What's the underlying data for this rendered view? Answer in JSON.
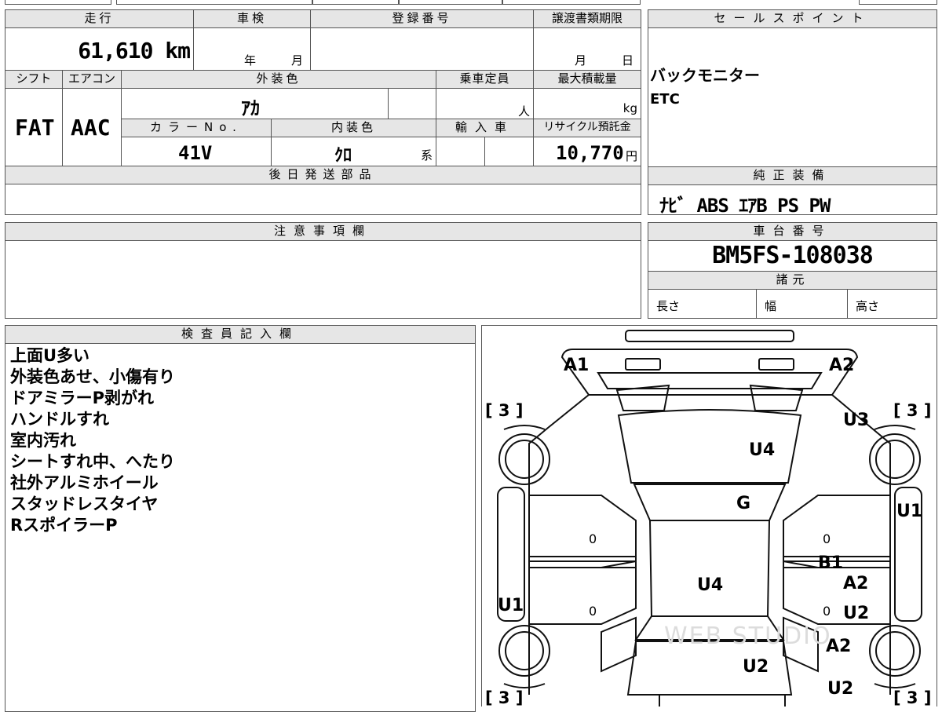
{
  "top_sheet": {
    "headers": {
      "mileage": "走行",
      "inspection": "車検",
      "registration": "登録番号",
      "transfer_deadline": "譲渡書類期限",
      "shift": "シフト",
      "aircon": "エアコン",
      "exterior_color": "外装色",
      "capacity": "乗車定員",
      "max_load": "最大積載量",
      "color_no": "カラーNo.",
      "interior_color": "内装色",
      "import": "輸入車",
      "recycle_fee": "リサイクル預託金",
      "later_parts": "後日発送部品",
      "notes": "注意事項欄"
    },
    "mileage_value": "61,610 km",
    "inspection_year_unit": "年",
    "inspection_month_unit": "月",
    "deadline_month_unit": "月",
    "deadline_day_unit": "日",
    "shift_value": "FAT",
    "aircon_value": "AAC",
    "exterior_color_value": "ｱｶ",
    "capacity_unit": "人",
    "max_load_unit": "kg",
    "color_no_value": "41V",
    "interior_color_value": "ｸﾛ",
    "interior_color_suffix": "系",
    "recycle_fee_value": "10,770",
    "recycle_fee_unit": "円"
  },
  "right_panel": {
    "sales_points_header": "セールスポイント",
    "sales_points": [
      "バックモニター",
      "ETC"
    ],
    "genuine_equipment_header": "純正装備",
    "genuine_equipment_value": "ﾅﾋﾞ  ABS ｴｱB PS PW",
    "chassis_number_header": "車台番号",
    "chassis_number_value": "BM5FS-108038",
    "specs_header": "諸元",
    "length_label": "長さ",
    "width_label": "幅",
    "height_label": "高さ"
  },
  "inspector": {
    "header": "検査員記入欄",
    "lines": [
      "上面U多い",
      "外装色あせ、小傷有り",
      "ドアミラーP剥がれ",
      "ハンドルすれ",
      "室内汚れ",
      "シートすれ中、へたり",
      "社外アルミホイール",
      "スタッドレスタイヤ",
      "RスポイラーP"
    ]
  },
  "diagram": {
    "marks": {
      "a1_front_left": "A1",
      "a2_front_right": "A2",
      "u3_right_front": "U3",
      "u4_hood": "U4",
      "g_windshield": "G",
      "u1_right": "U1",
      "b1_right_pillar": "B1",
      "a2_right_door": "A2",
      "u4_roof": "U4",
      "u1_left": "U1",
      "u2_right_rear_door": "U2",
      "a2_right_rear": "A2",
      "u2_trunk": "U2",
      "u2_rear_right": "U2"
    },
    "tire_tread": {
      "front_left": "[ 3 ]",
      "front_right": "[ 3 ]",
      "rear_left": "[ 3 ]",
      "rear_right": "[ 3 ]"
    },
    "zero_marks": {
      "left_front_door": "0",
      "left_rear_door": "0",
      "right_front_door": "0",
      "right_rear_door": "0"
    },
    "watermark": "WEB STUDIO"
  }
}
